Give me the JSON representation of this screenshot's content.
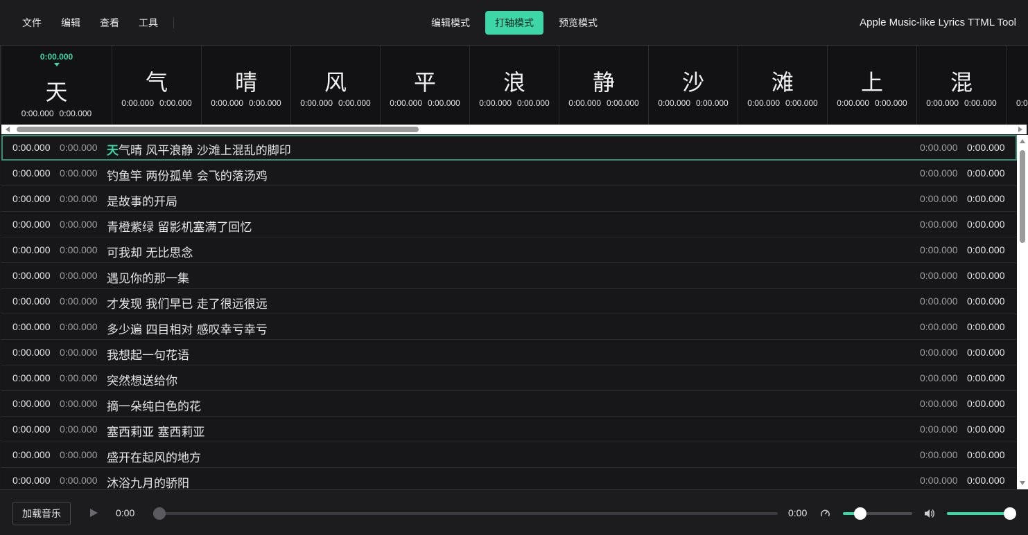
{
  "menu": {
    "items": [
      {
        "label": "文件"
      },
      {
        "label": "编辑"
      },
      {
        "label": "查看"
      },
      {
        "label": "工具"
      }
    ]
  },
  "modes": {
    "items": [
      {
        "label": "编辑模式",
        "active": false
      },
      {
        "label": "打轴模式",
        "active": true
      },
      {
        "label": "预览模式",
        "active": false
      }
    ]
  },
  "app_title": "Apple Music-like Lyrics TTML Tool",
  "wordstrip": {
    "current_time": "0:00.000",
    "words": [
      {
        "char": "天",
        "start": "0:00.000",
        "end": "0:00.000"
      },
      {
        "char": "气",
        "start": "0:00.000",
        "end": "0:00.000"
      },
      {
        "char": "晴",
        "start": "0:00.000",
        "end": "0:00.000"
      },
      {
        "char": "风",
        "start": "0:00.000",
        "end": "0:00.000"
      },
      {
        "char": "平",
        "start": "0:00.000",
        "end": "0:00.000"
      },
      {
        "char": "浪",
        "start": "0:00.000",
        "end": "0:00.000"
      },
      {
        "char": "静",
        "start": "0:00.000",
        "end": "0:00.000"
      },
      {
        "char": "沙",
        "start": "0:00.000",
        "end": "0:00.000"
      },
      {
        "char": "滩",
        "start": "0:00.000",
        "end": "0:00.000"
      },
      {
        "char": "上",
        "start": "0:00.000",
        "end": "0:00.000"
      },
      {
        "char": "混",
        "start": "0:00.000",
        "end": "0:00.000"
      },
      {
        "char": "",
        "start": "0:0",
        "end": ""
      }
    ]
  },
  "lyrics": {
    "rows": [
      {
        "start": "0:00.000",
        "end": "0:00.000",
        "highlight": "天",
        "text": "气晴 风平浪静 沙滩上混乱的脚印",
        "r_start": "0:00.000",
        "r_end": "0:00.000"
      },
      {
        "start": "0:00.000",
        "end": "0:00.000",
        "highlight": "",
        "text": "钓鱼竿 两份孤单 会飞的落汤鸡",
        "r_start": "0:00.000",
        "r_end": "0:00.000"
      },
      {
        "start": "0:00.000",
        "end": "0:00.000",
        "highlight": "",
        "text": "是故事的开局",
        "r_start": "0:00.000",
        "r_end": "0:00.000"
      },
      {
        "start": "0:00.000",
        "end": "0:00.000",
        "highlight": "",
        "text": "青橙紫绿 留影机塞满了回忆",
        "r_start": "0:00.000",
        "r_end": "0:00.000"
      },
      {
        "start": "0:00.000",
        "end": "0:00.000",
        "highlight": "",
        "text": "可我却 无比思念",
        "r_start": "0:00.000",
        "r_end": "0:00.000"
      },
      {
        "start": "0:00.000",
        "end": "0:00.000",
        "highlight": "",
        "text": "遇见你的那一集",
        "r_start": "0:00.000",
        "r_end": "0:00.000"
      },
      {
        "start": "0:00.000",
        "end": "0:00.000",
        "highlight": "",
        "text": "才发现 我们早已 走了很远很远",
        "r_start": "0:00.000",
        "r_end": "0:00.000"
      },
      {
        "start": "0:00.000",
        "end": "0:00.000",
        "highlight": "",
        "text": "多少遍 四目相对 感叹幸亏幸亏",
        "r_start": "0:00.000",
        "r_end": "0:00.000"
      },
      {
        "start": "0:00.000",
        "end": "0:00.000",
        "highlight": "",
        "text": "我想起一句花语",
        "r_start": "0:00.000",
        "r_end": "0:00.000"
      },
      {
        "start": "0:00.000",
        "end": "0:00.000",
        "highlight": "",
        "text": "突然想送给你",
        "r_start": "0:00.000",
        "r_end": "0:00.000"
      },
      {
        "start": "0:00.000",
        "end": "0:00.000",
        "highlight": "",
        "text": "摘一朵纯白色的花",
        "r_start": "0:00.000",
        "r_end": "0:00.000"
      },
      {
        "start": "0:00.000",
        "end": "0:00.000",
        "highlight": "",
        "text": "塞西莉亚 塞西莉亚",
        "r_start": "0:00.000",
        "r_end": "0:00.000"
      },
      {
        "start": "0:00.000",
        "end": "0:00.000",
        "highlight": "",
        "text": "盛开在起风的地方",
        "r_start": "0:00.000",
        "r_end": "0:00.000"
      },
      {
        "start": "0:00.000",
        "end": "0:00.000",
        "highlight": "",
        "text": "沐浴九月的骄阳",
        "r_start": "0:00.000",
        "r_end": "0:00.000"
      }
    ]
  },
  "player": {
    "load_label": "加载音乐",
    "current_time": "0:00",
    "total_time": "0:00",
    "progress_fraction": 0,
    "speed_fraction": 0.25,
    "volume_fraction": 1.0,
    "play_icon": "play-icon",
    "speed_icon": "gauge-icon",
    "volume_icon": "speaker-icon"
  },
  "colors": {
    "accent": "#3dd6a7",
    "background": "#18181b",
    "active_row_border": "#3b8f79"
  }
}
